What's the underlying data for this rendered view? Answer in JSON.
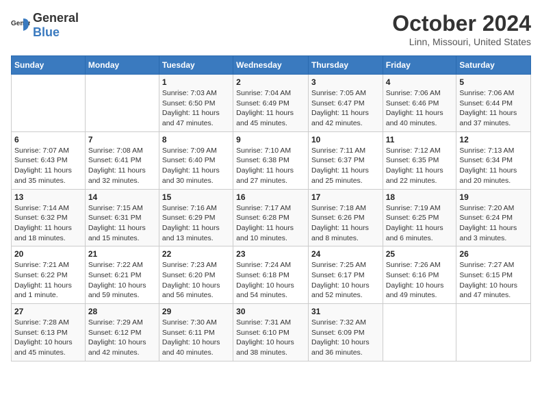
{
  "logo": {
    "general": "General",
    "blue": "Blue"
  },
  "title": "October 2024",
  "subtitle": "Linn, Missouri, United States",
  "headers": [
    "Sunday",
    "Monday",
    "Tuesday",
    "Wednesday",
    "Thursday",
    "Friday",
    "Saturday"
  ],
  "weeks": [
    [
      {
        "day": "",
        "sunrise": "",
        "sunset": "",
        "daylight": ""
      },
      {
        "day": "",
        "sunrise": "",
        "sunset": "",
        "daylight": ""
      },
      {
        "day": "1",
        "sunrise": "Sunrise: 7:03 AM",
        "sunset": "Sunset: 6:50 PM",
        "daylight": "Daylight: 11 hours and 47 minutes."
      },
      {
        "day": "2",
        "sunrise": "Sunrise: 7:04 AM",
        "sunset": "Sunset: 6:49 PM",
        "daylight": "Daylight: 11 hours and 45 minutes."
      },
      {
        "day": "3",
        "sunrise": "Sunrise: 7:05 AM",
        "sunset": "Sunset: 6:47 PM",
        "daylight": "Daylight: 11 hours and 42 minutes."
      },
      {
        "day": "4",
        "sunrise": "Sunrise: 7:06 AM",
        "sunset": "Sunset: 6:46 PM",
        "daylight": "Daylight: 11 hours and 40 minutes."
      },
      {
        "day": "5",
        "sunrise": "Sunrise: 7:06 AM",
        "sunset": "Sunset: 6:44 PM",
        "daylight": "Daylight: 11 hours and 37 minutes."
      }
    ],
    [
      {
        "day": "6",
        "sunrise": "Sunrise: 7:07 AM",
        "sunset": "Sunset: 6:43 PM",
        "daylight": "Daylight: 11 hours and 35 minutes."
      },
      {
        "day": "7",
        "sunrise": "Sunrise: 7:08 AM",
        "sunset": "Sunset: 6:41 PM",
        "daylight": "Daylight: 11 hours and 32 minutes."
      },
      {
        "day": "8",
        "sunrise": "Sunrise: 7:09 AM",
        "sunset": "Sunset: 6:40 PM",
        "daylight": "Daylight: 11 hours and 30 minutes."
      },
      {
        "day": "9",
        "sunrise": "Sunrise: 7:10 AM",
        "sunset": "Sunset: 6:38 PM",
        "daylight": "Daylight: 11 hours and 27 minutes."
      },
      {
        "day": "10",
        "sunrise": "Sunrise: 7:11 AM",
        "sunset": "Sunset: 6:37 PM",
        "daylight": "Daylight: 11 hours and 25 minutes."
      },
      {
        "day": "11",
        "sunrise": "Sunrise: 7:12 AM",
        "sunset": "Sunset: 6:35 PM",
        "daylight": "Daylight: 11 hours and 22 minutes."
      },
      {
        "day": "12",
        "sunrise": "Sunrise: 7:13 AM",
        "sunset": "Sunset: 6:34 PM",
        "daylight": "Daylight: 11 hours and 20 minutes."
      }
    ],
    [
      {
        "day": "13",
        "sunrise": "Sunrise: 7:14 AM",
        "sunset": "Sunset: 6:32 PM",
        "daylight": "Daylight: 11 hours and 18 minutes."
      },
      {
        "day": "14",
        "sunrise": "Sunrise: 7:15 AM",
        "sunset": "Sunset: 6:31 PM",
        "daylight": "Daylight: 11 hours and 15 minutes."
      },
      {
        "day": "15",
        "sunrise": "Sunrise: 7:16 AM",
        "sunset": "Sunset: 6:29 PM",
        "daylight": "Daylight: 11 hours and 13 minutes."
      },
      {
        "day": "16",
        "sunrise": "Sunrise: 7:17 AM",
        "sunset": "Sunset: 6:28 PM",
        "daylight": "Daylight: 11 hours and 10 minutes."
      },
      {
        "day": "17",
        "sunrise": "Sunrise: 7:18 AM",
        "sunset": "Sunset: 6:26 PM",
        "daylight": "Daylight: 11 hours and 8 minutes."
      },
      {
        "day": "18",
        "sunrise": "Sunrise: 7:19 AM",
        "sunset": "Sunset: 6:25 PM",
        "daylight": "Daylight: 11 hours and 6 minutes."
      },
      {
        "day": "19",
        "sunrise": "Sunrise: 7:20 AM",
        "sunset": "Sunset: 6:24 PM",
        "daylight": "Daylight: 11 hours and 3 minutes."
      }
    ],
    [
      {
        "day": "20",
        "sunrise": "Sunrise: 7:21 AM",
        "sunset": "Sunset: 6:22 PM",
        "daylight": "Daylight: 11 hours and 1 minute."
      },
      {
        "day": "21",
        "sunrise": "Sunrise: 7:22 AM",
        "sunset": "Sunset: 6:21 PM",
        "daylight": "Daylight: 10 hours and 59 minutes."
      },
      {
        "day": "22",
        "sunrise": "Sunrise: 7:23 AM",
        "sunset": "Sunset: 6:20 PM",
        "daylight": "Daylight: 10 hours and 56 minutes."
      },
      {
        "day": "23",
        "sunrise": "Sunrise: 7:24 AM",
        "sunset": "Sunset: 6:18 PM",
        "daylight": "Daylight: 10 hours and 54 minutes."
      },
      {
        "day": "24",
        "sunrise": "Sunrise: 7:25 AM",
        "sunset": "Sunset: 6:17 PM",
        "daylight": "Daylight: 10 hours and 52 minutes."
      },
      {
        "day": "25",
        "sunrise": "Sunrise: 7:26 AM",
        "sunset": "Sunset: 6:16 PM",
        "daylight": "Daylight: 10 hours and 49 minutes."
      },
      {
        "day": "26",
        "sunrise": "Sunrise: 7:27 AM",
        "sunset": "Sunset: 6:15 PM",
        "daylight": "Daylight: 10 hours and 47 minutes."
      }
    ],
    [
      {
        "day": "27",
        "sunrise": "Sunrise: 7:28 AM",
        "sunset": "Sunset: 6:13 PM",
        "daylight": "Daylight: 10 hours and 45 minutes."
      },
      {
        "day": "28",
        "sunrise": "Sunrise: 7:29 AM",
        "sunset": "Sunset: 6:12 PM",
        "daylight": "Daylight: 10 hours and 42 minutes."
      },
      {
        "day": "29",
        "sunrise": "Sunrise: 7:30 AM",
        "sunset": "Sunset: 6:11 PM",
        "daylight": "Daylight: 10 hours and 40 minutes."
      },
      {
        "day": "30",
        "sunrise": "Sunrise: 7:31 AM",
        "sunset": "Sunset: 6:10 PM",
        "daylight": "Daylight: 10 hours and 38 minutes."
      },
      {
        "day": "31",
        "sunrise": "Sunrise: 7:32 AM",
        "sunset": "Sunset: 6:09 PM",
        "daylight": "Daylight: 10 hours and 36 minutes."
      },
      {
        "day": "",
        "sunrise": "",
        "sunset": "",
        "daylight": ""
      },
      {
        "day": "",
        "sunrise": "",
        "sunset": "",
        "daylight": ""
      }
    ]
  ]
}
